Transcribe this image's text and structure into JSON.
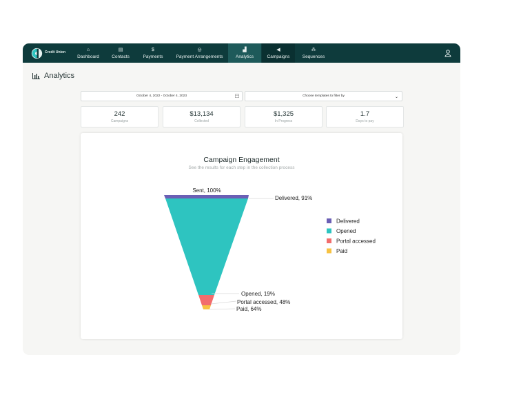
{
  "brand": {
    "name": "Credit Union"
  },
  "nav": {
    "items": [
      {
        "label": "Dashboard",
        "icon": "home-icon",
        "glyph": "⌂"
      },
      {
        "label": "Contacts",
        "icon": "contacts-icon",
        "glyph": "▤"
      },
      {
        "label": "Payments",
        "icon": "dollar-icon",
        "glyph": "$"
      },
      {
        "label": "Payment Arrangements",
        "icon": "arrangements-icon",
        "glyph": "◎"
      },
      {
        "label": "Analytics",
        "icon": "analytics-icon",
        "glyph": "▟"
      },
      {
        "label": "Campaigns",
        "icon": "megaphone-icon",
        "glyph": "◀"
      },
      {
        "label": "Sequences",
        "icon": "sequence-icon",
        "glyph": "⁂"
      }
    ],
    "active": "Analytics"
  },
  "page": {
    "title": "Analytics"
  },
  "filters": {
    "date_range": "October 4, 2022 - October 4, 2023",
    "template_placeholder": "Choose templates to filter by"
  },
  "kpis": [
    {
      "value": "242",
      "label": "Campaigns"
    },
    {
      "value": "$13,134",
      "label": "Collected"
    },
    {
      "value": "$1,325",
      "label": "In Progress"
    },
    {
      "value": "1.7",
      "label": "Days to pay"
    }
  ],
  "chart_data": {
    "type": "funnel",
    "title": "Campaign Engagement",
    "subtitle": "See the results for each step in the collection process",
    "stages": [
      {
        "label": "Sent, 100%",
        "name": "Sent",
        "value": 100
      },
      {
        "label": "Delivered, 91%",
        "name": "Delivered",
        "value": 91,
        "color": "#6b5fb5"
      },
      {
        "label": "Opened, 19%",
        "name": "Opened",
        "value": 19,
        "color": "#2ec4c0"
      },
      {
        "label": "Portal accessed, 48%",
        "name": "Portal accessed",
        "value": 48,
        "color": "#f26d6d"
      },
      {
        "label": "Paid, 64%",
        "name": "Paid",
        "value": 64,
        "color": "#f7c242"
      }
    ],
    "legend": [
      {
        "name": "Delivered",
        "color": "#6b5fb5"
      },
      {
        "name": "Opened",
        "color": "#2ec4c0"
      },
      {
        "name": "Portal accessed",
        "color": "#f26d6d"
      },
      {
        "name": "Paid",
        "color": "#f7c242"
      }
    ],
    "legend_position": "right"
  }
}
